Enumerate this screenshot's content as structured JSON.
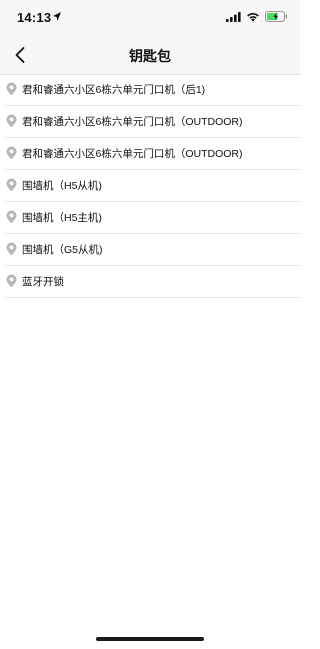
{
  "status_bar": {
    "time": "14:13",
    "icons": [
      "location-arrow-icon",
      "cellular-signal-icon",
      "wifi-icon",
      "battery-charging-icon"
    ],
    "battery_color": "#4cd964"
  },
  "nav": {
    "title": "钥匙包",
    "back_icon": "chevron-left-icon"
  },
  "keys": [
    {
      "label": "君和睿通六小区6栋六单元门口机（后1)",
      "icon": "location-pin-icon"
    },
    {
      "label": "君和睿通六小区6栋六单元门口机（OUTDOOR)",
      "icon": "location-pin-icon"
    },
    {
      "label": "君和睿通六小区6栋六单元门口机（OUTDOOR)",
      "icon": "location-pin-icon"
    },
    {
      "label": "围墙机（H5从机)",
      "icon": "location-pin-icon"
    },
    {
      "label": "围墙机（H5主机)",
      "icon": "location-pin-icon"
    },
    {
      "label": "围墙机（G5从机)",
      "icon": "location-pin-icon"
    },
    {
      "label": "蓝牙开锁",
      "icon": "location-pin-icon"
    }
  ]
}
